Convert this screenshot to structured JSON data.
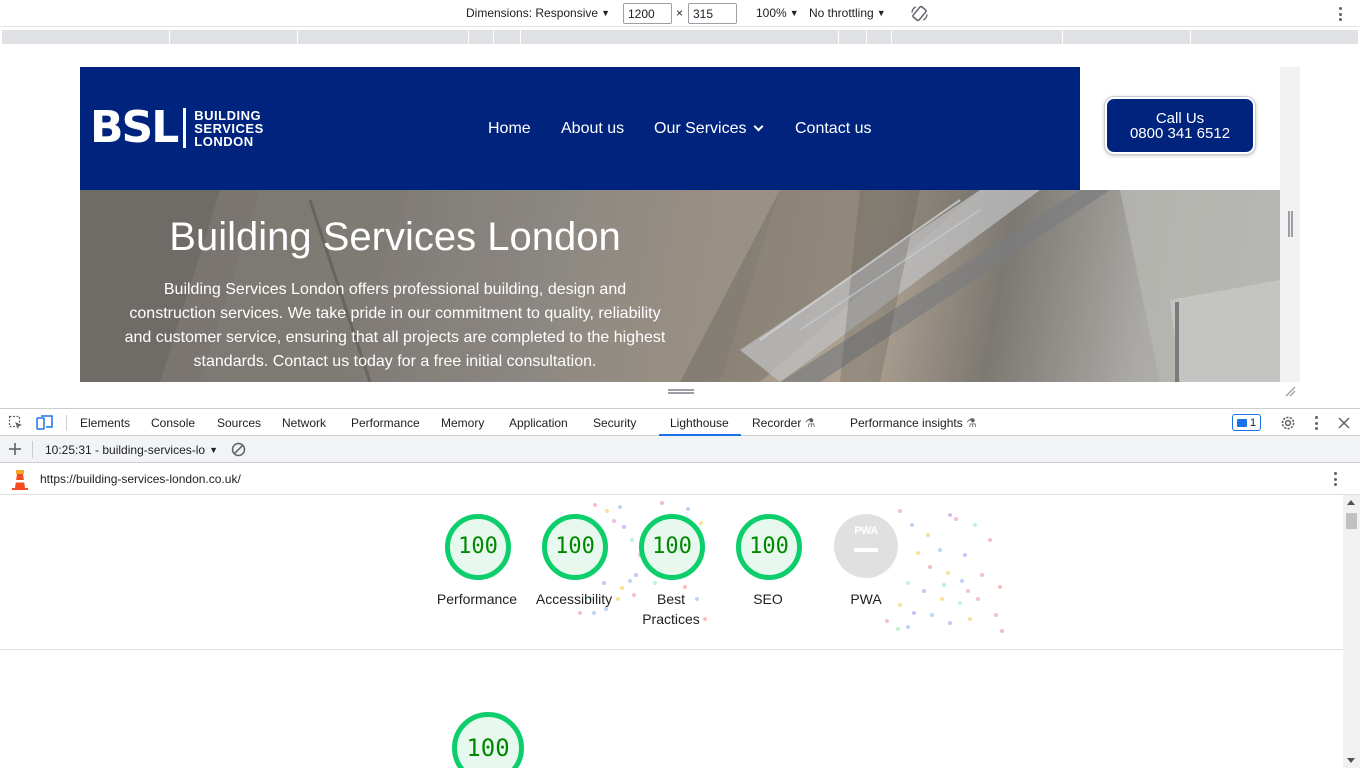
{
  "device_toolbar": {
    "dimensions_label": "Dimensions: Responsive",
    "width_value": "1200",
    "height_value": "315",
    "times": "×",
    "zoom": "100%",
    "throttling": "No throttling"
  },
  "site": {
    "logo_mark": "BSL",
    "logo_line1": "BUILDING",
    "logo_line2": "SERVICES",
    "logo_line3": "LONDON",
    "nav": {
      "home": "Home",
      "about": "About us",
      "services": "Our Services",
      "contact": "Contact us"
    },
    "call_line1": "Call Us",
    "call_line2": "0800 341 6512",
    "hero_title": "Building Services London",
    "hero_text": "Building Services London offers professional building, design and construction services. We take pride in our commitment to quality, reliability and customer service, ensuring that all projects are completed to the highest standards. Contact us today for a free initial consultation.",
    "brand_color": "#00247d"
  },
  "devtools": {
    "tabs": {
      "elements": "Elements",
      "console": "Console",
      "sources": "Sources",
      "network": "Network",
      "performance": "Performance",
      "memory": "Memory",
      "application": "Application",
      "security": "Security",
      "lighthouse": "Lighthouse",
      "recorder": "Recorder",
      "performance_insights": "Performance insights"
    },
    "issues_count": "1",
    "report_selector": "10:25:31 - building-services-lo",
    "report_url": "https://building-services-london.co.uk/",
    "accent_color": "#1a73e8"
  },
  "lighthouse": {
    "scores": {
      "performance": {
        "label": "Performance",
        "score": "100"
      },
      "accessibility": {
        "label": "Accessibility",
        "score": "100"
      },
      "best_practices_1": "Best",
      "best_practices_2": "Practices",
      "best_practices_score": "100",
      "seo": {
        "label": "SEO",
        "score": "100"
      },
      "pwa": {
        "label": "PWA",
        "badge": "PWA"
      }
    },
    "performance_detail_score": "100",
    "pass_color": "#0cce6b"
  }
}
